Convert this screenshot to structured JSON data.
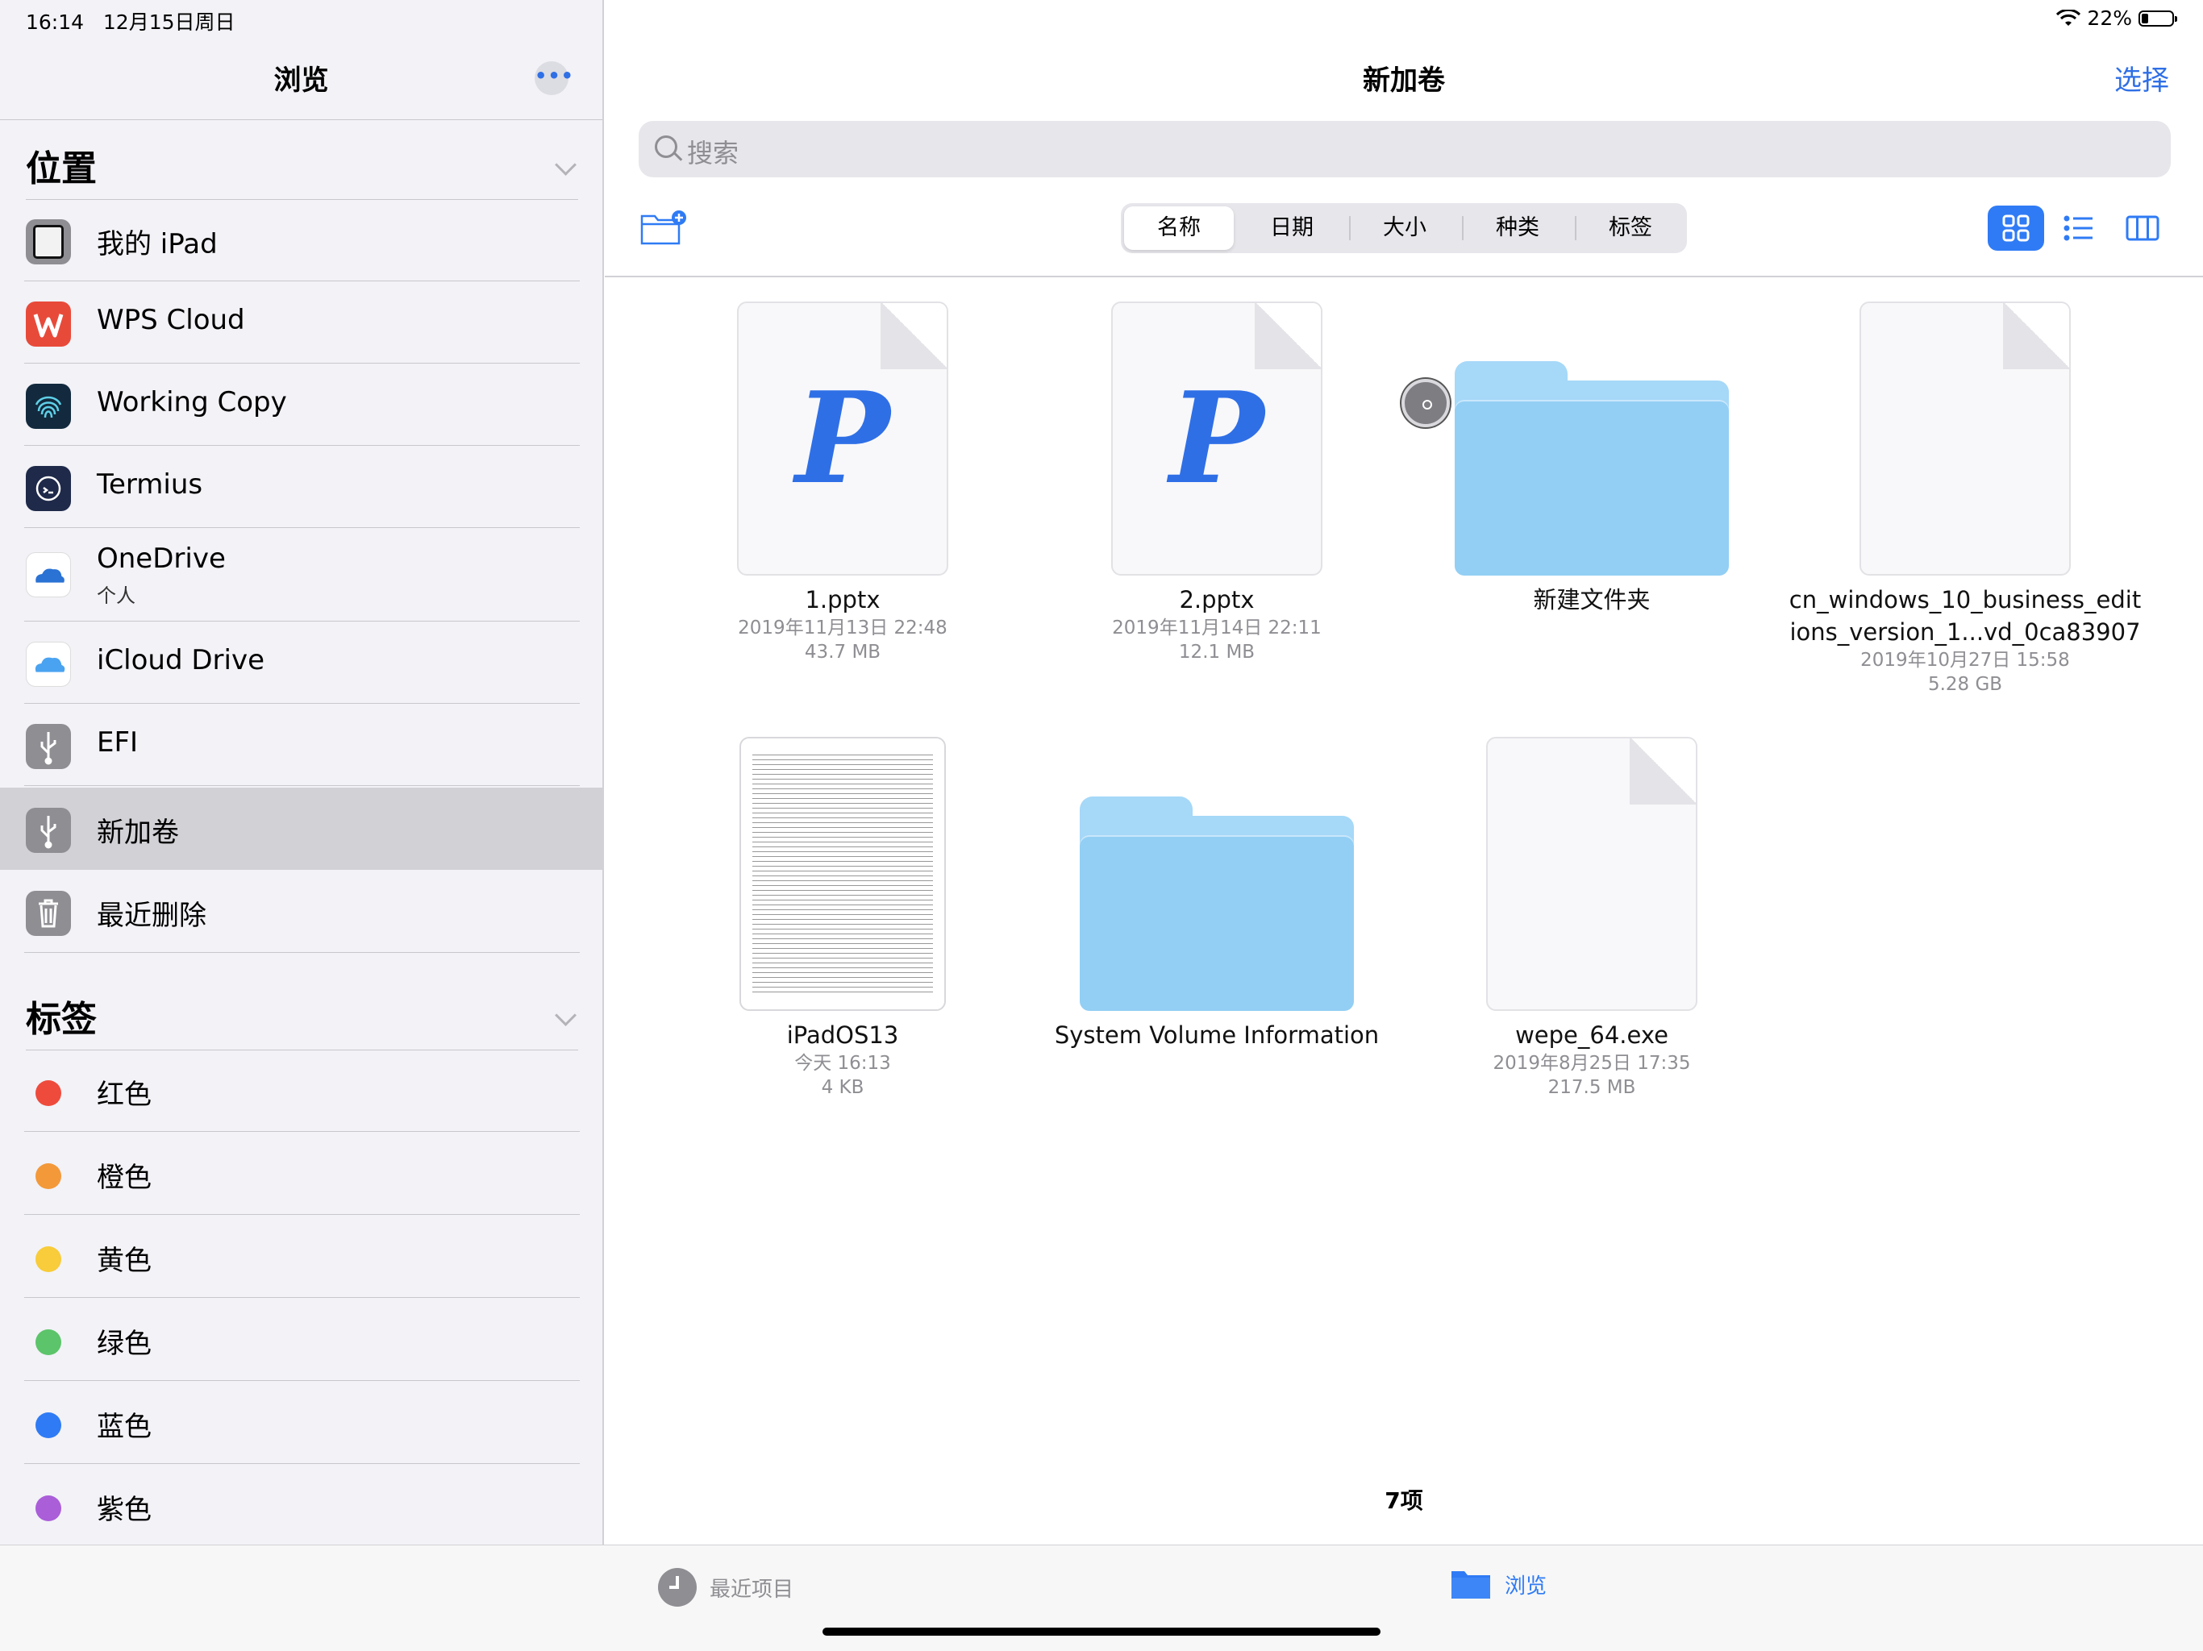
{
  "status": {
    "time": "16:14",
    "date": "12月15日周日",
    "battery": "22%"
  },
  "sidebar": {
    "title": "浏览",
    "more_glyph": "•••",
    "locations_header": "位置",
    "locations": [
      {
        "label": "我的 iPad",
        "icon": "ipad-icon"
      },
      {
        "label": "WPS Cloud",
        "icon": "wps-icon"
      },
      {
        "label": "Working Copy",
        "icon": "fingerprint-icon"
      },
      {
        "label": "Termius",
        "icon": "termius-icon"
      },
      {
        "label": "OneDrive",
        "sublabel": "个人",
        "icon": "onedrive-icon"
      },
      {
        "label": "iCloud Drive",
        "icon": "icloud-icon"
      },
      {
        "label": "EFI",
        "icon": "usb-icon"
      },
      {
        "label": "新加卷",
        "icon": "usb-icon",
        "selected": true
      },
      {
        "label": "最近删除",
        "icon": "trash-icon"
      }
    ],
    "tags_header": "标签",
    "tags": [
      {
        "label": "红色",
        "color": "#ee4b3c"
      },
      {
        "label": "橙色",
        "color": "#f3993a"
      },
      {
        "label": "黄色",
        "color": "#f8cc3a"
      },
      {
        "label": "绿色",
        "color": "#5cc46a"
      },
      {
        "label": "蓝色",
        "color": "#2f7bf5"
      },
      {
        "label": "紫色",
        "color": "#aa5ed8"
      }
    ]
  },
  "main": {
    "title": "新加卷",
    "select_label": "选择",
    "search_placeholder": "搜索",
    "sort_tabs": [
      "名称",
      "日期",
      "大小",
      "种类",
      "标签"
    ],
    "active_sort": "名称",
    "items": [
      {
        "name": "1.pptx",
        "date": "2019年11月13日 22:48",
        "size": "43.7 MB",
        "kind": "pptx"
      },
      {
        "name": "2.pptx",
        "date": "2019年11月14日 22:11",
        "size": "12.1 MB",
        "kind": "pptx"
      },
      {
        "name": "新建文件夹",
        "kind": "folder"
      },
      {
        "name": "cn_windows_10_business_editions_version_1...vd_0ca83907",
        "name_line1": "cn_windows_10_business_edit",
        "name_line2": "ions_version_1...vd_0ca83907",
        "date": "2019年10月27日 15:58",
        "size": "5.28 GB",
        "kind": "blank"
      },
      {
        "name": "iPadOS13",
        "date": "今天 16:13",
        "size": "4 KB",
        "kind": "text"
      },
      {
        "name": "System Volume Information",
        "kind": "folder"
      },
      {
        "name": "wepe_64.exe",
        "date": "2019年8月25日 17:35",
        "size": "217.5 MB",
        "kind": "blank"
      }
    ],
    "count_label": "7项"
  },
  "tabbar": {
    "recent_label": "最近项目",
    "browse_label": "浏览"
  },
  "colors": {
    "accent": "#2f7bf5",
    "folder": "#93cff4"
  }
}
